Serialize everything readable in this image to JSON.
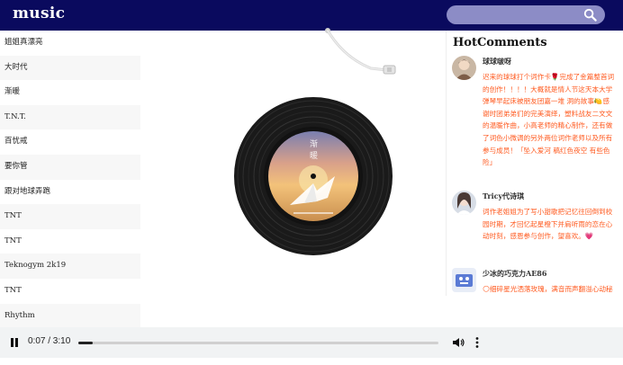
{
  "header": {
    "brand": "music",
    "search_placeholder": "",
    "colors": {
      "bar": "#0a0a5e",
      "search": "#8c8cc6"
    }
  },
  "songs": [
    "姐姐真漂亮",
    "大时代",
    "渐暖",
    "T.N.T.",
    "百忧戒",
    "要你管",
    "跟对地球弄跑",
    "TNT",
    "TNT",
    "Teknogym 2k19",
    "TNT",
    "Rhythm"
  ],
  "album": {
    "cover_text_1": "渐",
    "cover_text_2": "暖",
    "icon": "paper-crane"
  },
  "comments_title": "HotComments",
  "comments": [
    {
      "user": "球球啵呀",
      "text": "迟来的球球打个词作卡🌹完成了金篇整首词的创作！！！！大概就是情人节这天本大学弹琴早起床被朋友团嘉一堆 洞的故事🍋感谢时团弟弟们的完美演绎，塑料战友二文文的温暖作曲，小高老师的精心制作，还有做了词色小微调的另外两位词作老师以及所有参与成员！「坠入爱河 稿红色夜空 有些色险」"
    },
    {
      "user": "Tricy代诗琪",
      "text": "词作老姐姐为了写小甜歌把记忆往回倒到校园时期，才回忆起星橙下并肩听雨的恋在心动时刻，感恩参与创作，望喜欢。💗"
    },
    {
      "user": "少冰的巧克力AE86",
      "text": "🌕细碎星光洒落玫瑰，满音而声翻溢心动秘密。🐝 刘耀文 🐝 暖芳的音唱让人陷入《渐暖》氛围，让光影追随，让火花绽放，让勇敢云翻情节歌染魂进🌕 ✨"
    }
  ],
  "audio": {
    "current": "0:07",
    "duration": "3:10",
    "time_display": "0:07 / 3:10",
    "progress": 0.04
  }
}
